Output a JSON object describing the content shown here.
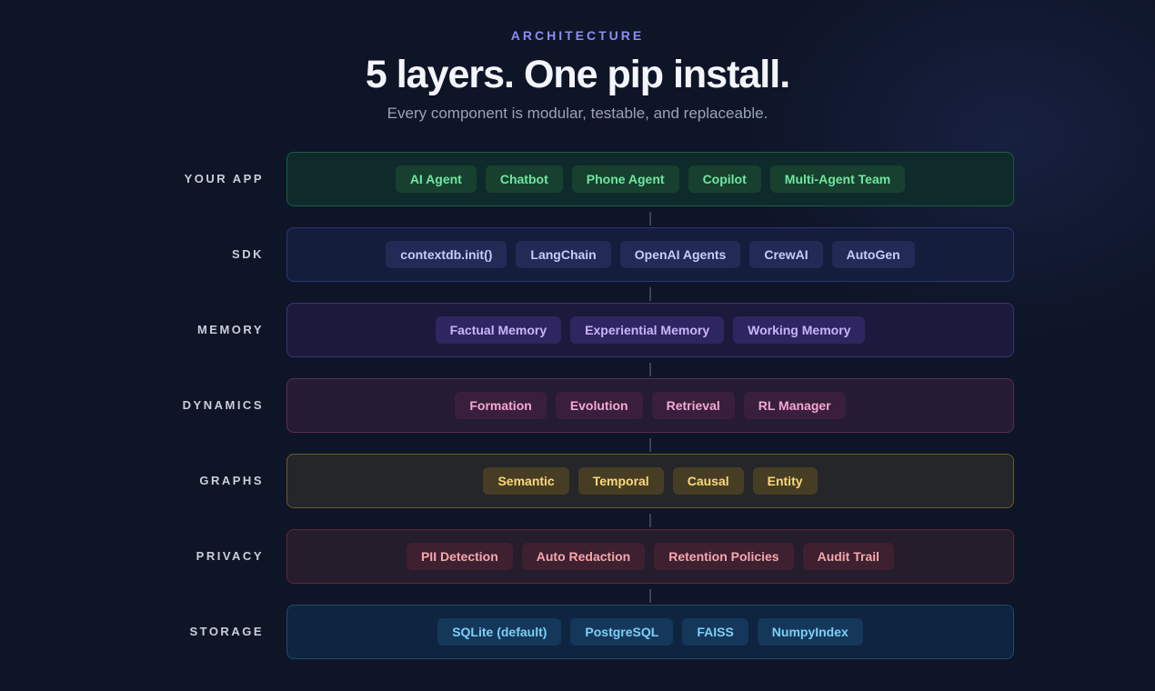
{
  "header": {
    "eyebrow": "ARCHITECTURE",
    "title": "5 layers. One pip install.",
    "subtitle": "Every component is modular, testable, and replaceable."
  },
  "layers": [
    {
      "label": "YOUR APP",
      "colors": {
        "bg": "#0f2a2a",
        "border": "#1f5a45",
        "chip_bg": "#17402f",
        "chip_text": "#6ee7a0"
      },
      "items": [
        "AI Agent",
        "Chatbot",
        "Phone Agent",
        "Copilot",
        "Multi-Agent Team"
      ]
    },
    {
      "label": "SDK",
      "colors": {
        "bg": "#151d3d",
        "border": "#2c3670",
        "chip_bg": "#222a55",
        "chip_text": "#c7cdf2"
      },
      "items": [
        "contextdb.init()",
        "LangChain",
        "OpenAI Agents",
        "CrewAI",
        "AutoGen"
      ]
    },
    {
      "label": "MEMORY",
      "colors": {
        "bg": "#1c1a3c",
        "border": "#3c3472",
        "chip_bg": "#2f2560",
        "chip_text": "#c8b4fa"
      },
      "items": [
        "Factual Memory",
        "Experiential Memory",
        "Working Memory"
      ]
    },
    {
      "label": "DYNAMICS",
      "colors": {
        "bg": "#251b33",
        "border": "#5a2e55",
        "chip_bg": "#3a1f3d",
        "chip_text": "#f3a8d2"
      },
      "items": [
        "Formation",
        "Evolution",
        "Retrieval",
        "RL Manager"
      ]
    },
    {
      "label": "GRAPHS",
      "colors": {
        "bg": "#25262a",
        "border": "#6b5a2a",
        "chip_bg": "#463d24",
        "chip_text": "#fcd979"
      },
      "items": [
        "Semantic",
        "Temporal",
        "Causal",
        "Entity"
      ]
    },
    {
      "label": "PRIVACY",
      "colors": {
        "bg": "#251c2c",
        "border": "#5e2a38",
        "chip_bg": "#3e2030",
        "chip_text": "#f7a6ad"
      },
      "items": [
        "PII Detection",
        "Auto Redaction",
        "Retention Policies",
        "Audit Trail"
      ]
    },
    {
      "label": "STORAGE",
      "colors": {
        "bg": "#0f2440",
        "border": "#1d4a66",
        "chip_bg": "#15375a",
        "chip_text": "#7dcff7"
      },
      "items": [
        "SQLite (default)",
        "PostgreSQL",
        "FAISS",
        "NumpyIndex"
      ]
    }
  ]
}
